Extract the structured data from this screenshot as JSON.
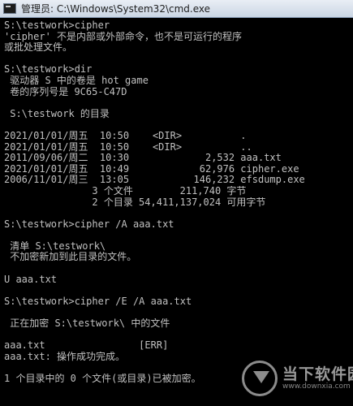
{
  "window": {
    "title": "管理员: C:\\Windows\\System32\\cmd.exe",
    "icon": "cmd-console-icon"
  },
  "console": {
    "lines": [
      "S:\\testwork>cipher",
      "'cipher' 不是内部或外部命令，也不是可运行的程序",
      "或批处理文件。",
      "",
      "S:\\testwork>dir",
      " 驱动器 S 中的卷是 hot game",
      " 卷的序列号是 9C65-C47D",
      "",
      " S:\\testwork 的目录",
      "",
      "2021/01/01/周五  10:50    <DIR>          .",
      "2021/01/01/周五  10:50    <DIR>          ..",
      "2011/09/06/周二  10:30             2,532 aaa.txt",
      "2021/01/01/周五  10:49            62,976 cipher.exe",
      "2006/11/01/周三  13:05           146,232 efsdump.exe",
      "               3 个文件        211,740 字节",
      "               2 个目录 54,411,137,024 可用字节",
      "",
      "S:\\testwork>cipher /A aaa.txt",
      "",
      " 清单 S:\\testwork\\",
      " 不加密新加到此目录的文件。",
      "",
      "U aaa.txt",
      "",
      "S:\\testwork>cipher /E /A aaa.txt",
      "",
      " 正在加密 S:\\testwork\\ 中的文件",
      "",
      "aaa.txt                [ERR]",
      "aaa.txt: 操作成功完成。",
      "",
      "1 个目录中的 0 个文件(或目录)已被加密。"
    ]
  },
  "watermark": {
    "name": "当下软件园",
    "url": "www.downxia.com",
    "icon": "download-arrow-logo"
  }
}
